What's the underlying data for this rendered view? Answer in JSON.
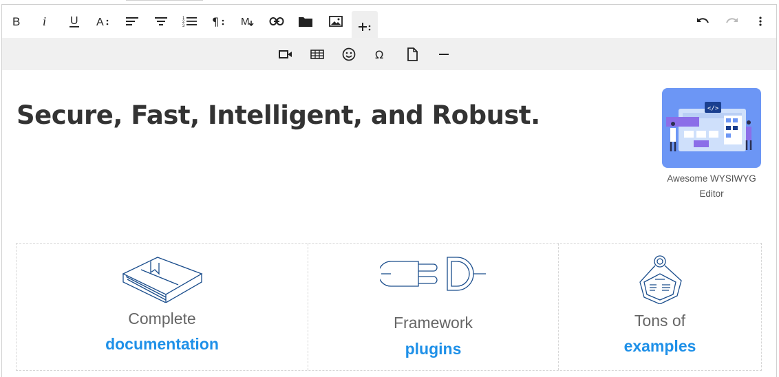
{
  "toolbar": {
    "primary": [
      {
        "name": "bold-button",
        "icon": "bold-icon"
      },
      {
        "name": "italic-button",
        "icon": "italic-icon"
      },
      {
        "name": "underline-button",
        "icon": "underline-icon"
      },
      {
        "name": "font-size-button",
        "icon": "font-size-icon"
      },
      {
        "name": "align-button",
        "icon": "align-left-icon"
      },
      {
        "name": "formats-button",
        "icon": "formats-icon"
      },
      {
        "name": "ordered-list-button",
        "icon": "ordered-list-icon"
      },
      {
        "name": "paragraph-button",
        "icon": "paragraph-icon"
      },
      {
        "name": "markdown-button",
        "icon": "markdown-icon"
      },
      {
        "name": "link-button",
        "icon": "link-icon"
      },
      {
        "name": "file-manager-button",
        "icon": "folder-icon"
      },
      {
        "name": "image-button",
        "icon": "image-icon"
      },
      {
        "name": "insert-more-button",
        "icon": "plus-icon"
      }
    ],
    "right": [
      "undo-icon",
      "redo-icon",
      "more-vertical-icon"
    ],
    "secondary": [
      "video-icon",
      "table-icon",
      "emoji-icon",
      "special-char-icon",
      "document-icon",
      "horizontal-line-icon"
    ]
  },
  "content": {
    "heading": "Secure, Fast, Intelligent, and Robust.",
    "figure": {
      "caption_line1": "Awesome WYSIWYG",
      "caption_line2": "Editor",
      "image": "wysiwyg-illustration"
    },
    "features": [
      {
        "text": "Complete",
        "link": "documentation",
        "icon": "book-icon"
      },
      {
        "text": "Framework",
        "link": "plugins",
        "icon": "plug-icon"
      },
      {
        "text": "Tons of",
        "link": "examples",
        "icon": "examples-icon"
      }
    ]
  },
  "colors": {
    "link": "#1e90e8",
    "heading": "#333333",
    "toolbar_secondary_bg": "#f0f0f0",
    "figure_bg": "#6c96f5",
    "icon_line": "#1a4d8c"
  }
}
